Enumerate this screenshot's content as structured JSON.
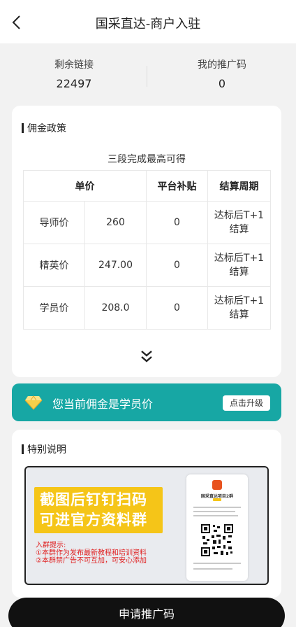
{
  "header": {
    "title": "国采直达-商户入驻",
    "back_icon": "chevron-left-icon"
  },
  "stats": {
    "remaining_label": "剩余链接",
    "remaining_value": "22497",
    "promo_label": "我的推广码",
    "promo_value": "0"
  },
  "policy": {
    "title": "佣金政策",
    "subtitle": "三段完成最高可得",
    "headers": [
      "单价",
      "平台补贴",
      "结算周期"
    ],
    "rows": [
      {
        "name": "导师价",
        "price": "260",
        "subsidy": "0",
        "cycle": "达标后T+1结算"
      },
      {
        "name": "精英价",
        "price": "247.00",
        "subsidy": "0",
        "cycle": "达标后T+1结算"
      },
      {
        "name": "学员价",
        "price": "208.0",
        "subsidy": "0",
        "cycle": "达标后T+1结算"
      }
    ],
    "expand_icon": "double-chevron-down-icon"
  },
  "level": {
    "text": "您当前佣金是学员价",
    "upgrade_label": "点击升级",
    "icon": "diamond-icon",
    "color": "#17a7a4"
  },
  "special": {
    "title": "特别说明",
    "promo_line1": "截图后钉钉扫码",
    "promo_line2": "可进官方资料群",
    "note_title": "入群提示:",
    "note_1": "①本群作为发布最新教程和培训资料",
    "note_2": "②本群禁广告不可互加，可安心添加",
    "phone_title": "国采直达项目2群"
  },
  "cta": {
    "label": "申请推广码"
  }
}
